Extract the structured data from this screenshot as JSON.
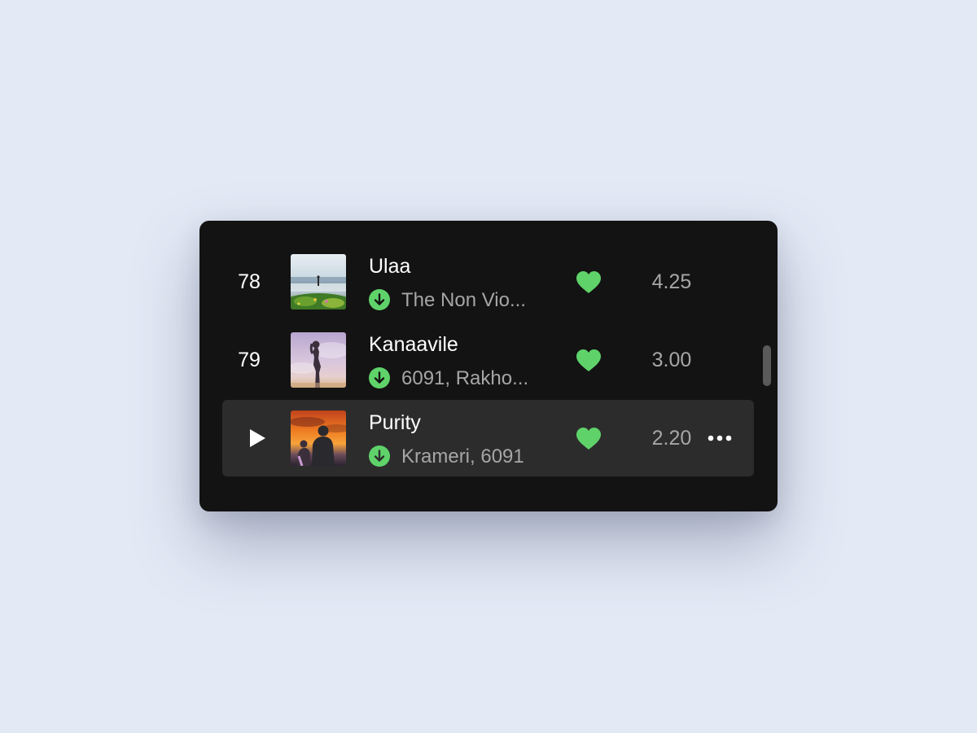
{
  "tracks": [
    {
      "number": "78",
      "title": "Ulaa",
      "artist": "The Non Vio...",
      "duration": "4.25",
      "liked": true,
      "downloaded": true,
      "active": false,
      "art": "sea-figure"
    },
    {
      "number": "79",
      "title": "Kanaavile",
      "artist": "6091, Rakho...",
      "duration": "3.00",
      "liked": true,
      "downloaded": true,
      "active": false,
      "art": "lavender-silhouette"
    },
    {
      "number": "",
      "title": "Purity",
      "artist": "Krameri, 6091",
      "duration": "2.20",
      "liked": true,
      "downloaded": true,
      "active": true,
      "art": "sunset-couple"
    }
  ],
  "icons": {
    "play": "play-icon",
    "download": "download-icon",
    "heart": "heart-icon",
    "more": "more-icon"
  },
  "colors": {
    "background": "#e3e9f5",
    "panel": "#131313",
    "active_row": "#2c2c2c",
    "accent_green": "#5fd36a",
    "primary_text": "#ffffff",
    "secondary_text": "#a6a6a6"
  }
}
